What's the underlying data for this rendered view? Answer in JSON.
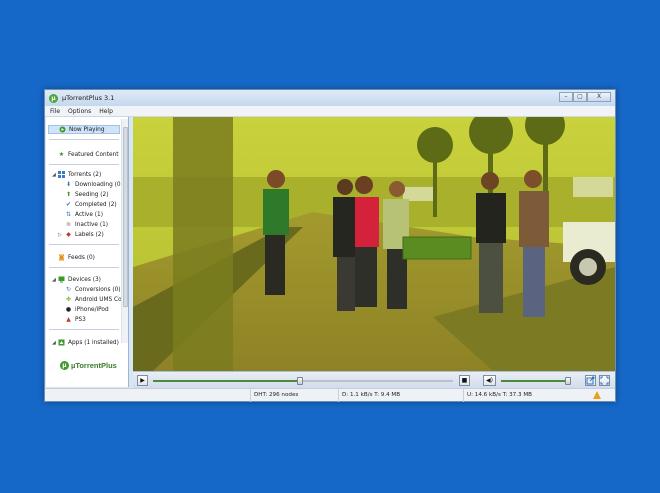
{
  "window": {
    "title": "µTorrentPlus 3.1"
  },
  "menu": [
    "File",
    "Options",
    "Help"
  ],
  "window_controls": {
    "minimize": "–",
    "maximize": "▢",
    "close": "X"
  },
  "sidebar": {
    "now_playing": "Now Playing",
    "featured": "Featured Content",
    "torrents": "Torrents (2)",
    "downloading": "Downloading (0)",
    "seeding": "Seeding (2)",
    "completed": "Completed (2)",
    "active": "Active (1)",
    "inactive": "Inactive (1)",
    "labels": "Labels (2)",
    "feeds": "Feeds (0)",
    "devices": "Devices (3)",
    "conversions": "Conversions (0)",
    "android": "Android UMS Co",
    "iphone": "iPhone/iPod",
    "ps3": "PS3",
    "apps": "Apps (1 installed)"
  },
  "logo": {
    "mark": "µ",
    "text": "µTorrentPlus"
  },
  "player": {
    "play": "▶",
    "stop": "■",
    "volume_icon": "◀)",
    "seek_position": 0.49,
    "volume_level": 0.95
  },
  "status": {
    "dht": "DHT: 296 nodes",
    "download": "D: 1.1 kB/s T: 9.4 MB",
    "upload": "U: 14.6 kB/s T: 37.3 MB"
  },
  "colors": {
    "desktop": "#1668c8",
    "accent_green": "#4aa53a",
    "warning": "#e8a11d"
  }
}
